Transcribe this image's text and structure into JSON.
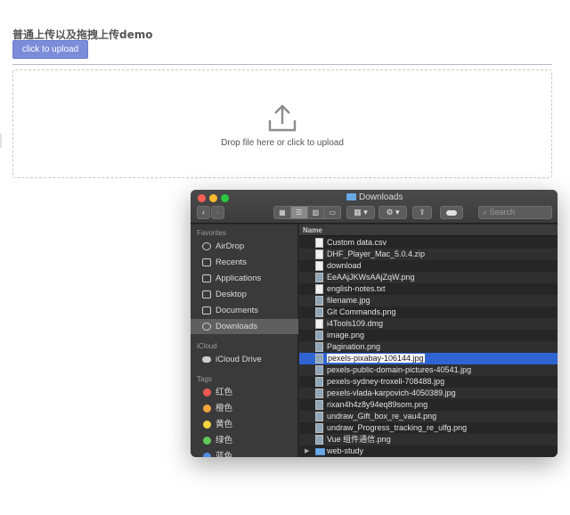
{
  "page": {
    "title": "普通上传以及拖拽上传demo",
    "upload_button": "click to upload",
    "drop_text": "Drop file here or click to upload"
  },
  "finder": {
    "window_title": "Downloads",
    "nav_back": "‹",
    "nav_forward": "›",
    "search_placeholder": "Search",
    "column_name": "Name",
    "sidebar": {
      "favorites_header": "Favorites",
      "favorites": [
        "AirDrop",
        "Recents",
        "Applications",
        "Desktop",
        "Documents",
        "Downloads"
      ],
      "icloud_header": "iCloud",
      "icloud": [
        "iCloud Drive"
      ],
      "tags_header": "Tags",
      "tags": [
        {
          "label": "红色",
          "color": "#ec5a53"
        },
        {
          "label": "橙色",
          "color": "#f1a43b"
        },
        {
          "label": "黄色",
          "color": "#f5d23f"
        },
        {
          "label": "绿色",
          "color": "#5fc95a"
        },
        {
          "label": "蓝色",
          "color": "#4c8fe6"
        }
      ]
    },
    "files": [
      "Custom data.csv",
      "DHF_Player_Mac_5.0.4.zip",
      "download",
      "EeAAjJKWsAAjZqW.png",
      "english-notes.txt",
      "filename.jpg",
      "Git Commands.png",
      "i4Tools109.dmg",
      "image.png",
      "Pagination.png",
      "pexels-pixabay-106144.jpg",
      "pexels-public-domain-pictures-40541.jpg",
      "pexels-sydney-troxell-708488.jpg",
      "pexels-vlada-karpovich-4050389.jpg",
      "rixan4h4z8y94eq89som.png",
      "undraw_Gift_box_re_vau4.png",
      "undraw_Progress_tracking_re_ulfg.png",
      "Vue 组件通信.png",
      "web-study"
    ],
    "selected_file": "pexels-pixabay-106144.jpg"
  }
}
